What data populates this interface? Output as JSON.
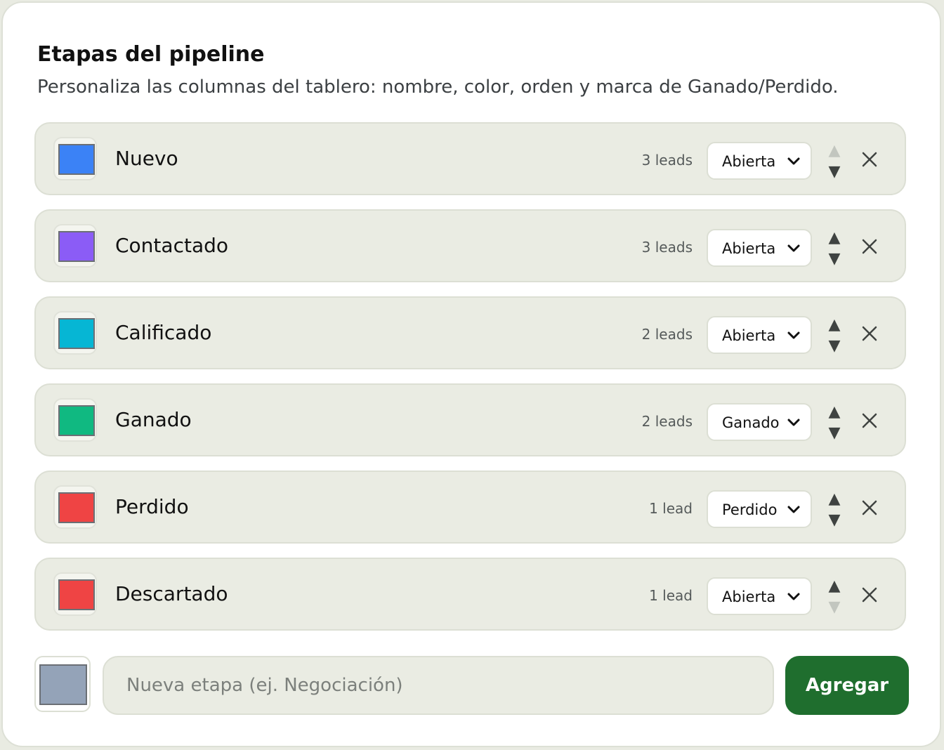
{
  "header": {
    "title": "Etapas del pipeline",
    "subtitle": "Personaliza las columnas del tablero: nombre, color, orden y marca de Ganado/Perdido."
  },
  "stages": [
    {
      "name": "Nuevo",
      "color": "#3b82f6",
      "count": "3 leads",
      "status": "Abierta",
      "up_enabled": false,
      "down_enabled": true
    },
    {
      "name": "Contactado",
      "color": "#8b5cf6",
      "count": "3 leads",
      "status": "Abierta",
      "up_enabled": true,
      "down_enabled": true
    },
    {
      "name": "Calificado",
      "color": "#06b6d4",
      "count": "2 leads",
      "status": "Abierta",
      "up_enabled": true,
      "down_enabled": true
    },
    {
      "name": "Ganado",
      "color": "#10b981",
      "count": "2 leads",
      "status": "Ganado",
      "up_enabled": true,
      "down_enabled": true
    },
    {
      "name": "Perdido",
      "color": "#ef4444",
      "count": "1 lead",
      "status": "Perdido",
      "up_enabled": true,
      "down_enabled": true
    },
    {
      "name": "Descartado",
      "color": "#ef4444",
      "count": "1 lead",
      "status": "Abierta",
      "up_enabled": true,
      "down_enabled": false
    }
  ],
  "icons": {
    "up": "triangle-up-icon",
    "down": "triangle-down-icon",
    "remove": "close-icon",
    "dropdown": "chevron-down-icon"
  },
  "new_stage": {
    "color": "#94a3b8",
    "placeholder": "Nueva etapa (ej. Negociación)",
    "value": "",
    "button_label": "Agregar"
  },
  "colors": {
    "accent": "#1f6e2e",
    "row_background": "#eaece3"
  }
}
